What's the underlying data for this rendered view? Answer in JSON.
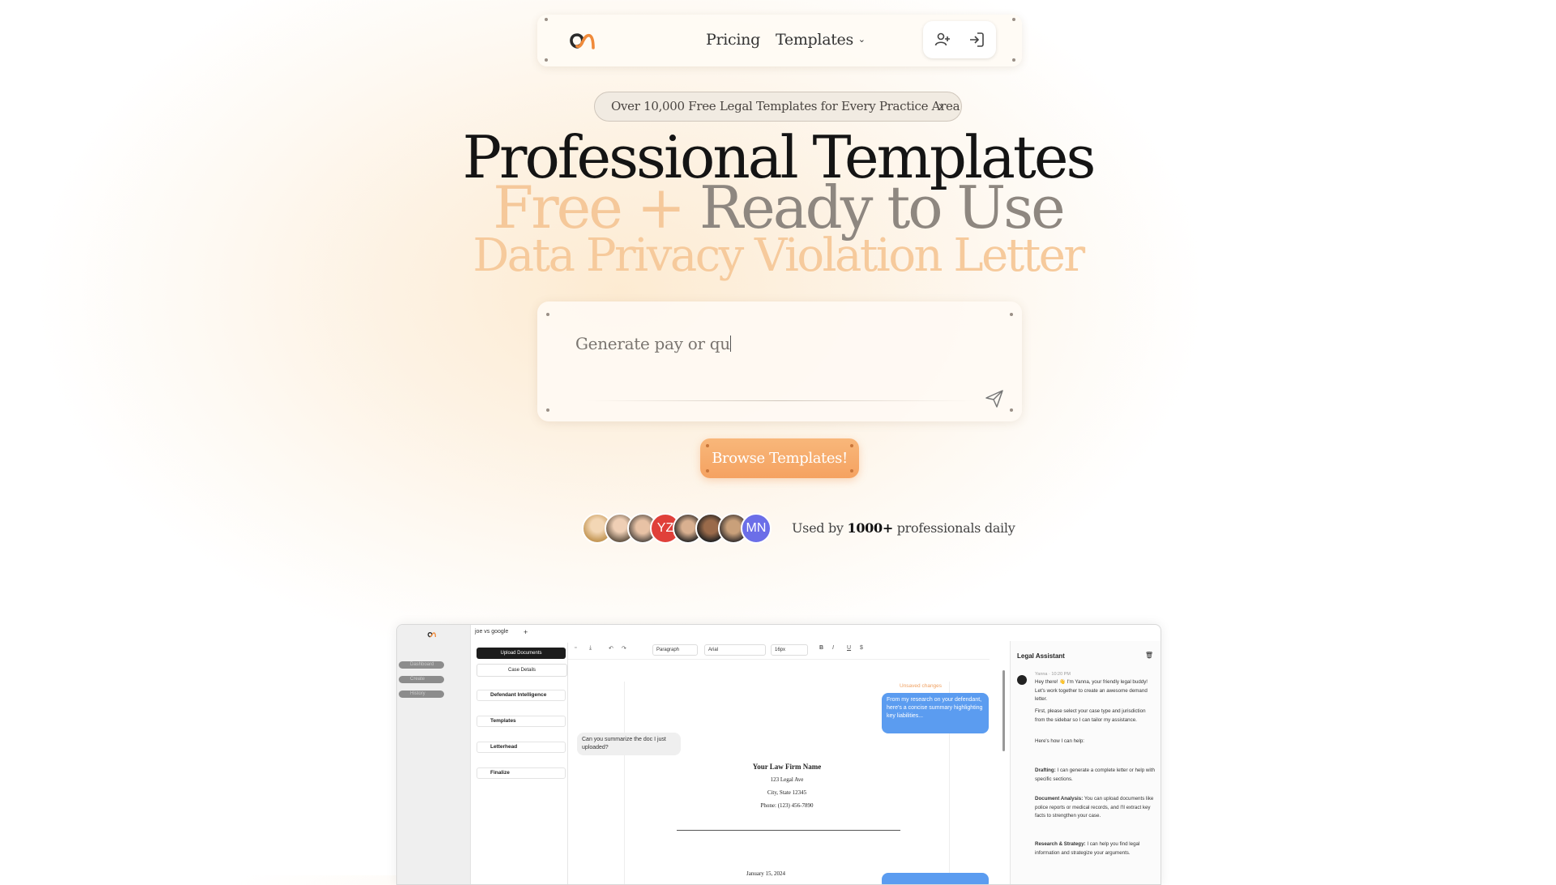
{
  "nav": {
    "pricing": "Pricing",
    "templates": "Templates",
    "templates_chevron": "⌄",
    "icons": [
      "logo-icon",
      "add-user-icon",
      "sign-in-icon"
    ]
  },
  "banner": {
    "text": "Over 10,000 Free Legal Templates for Every Practice Area",
    "arrow": "›"
  },
  "hero": {
    "line1": "Professional Templates",
    "line2_a": "Free +",
    "line2_b": "Ready to Use",
    "line3": "Data Privacy Violation Letter"
  },
  "prompt": {
    "text": "Generate pay or qu"
  },
  "cta": {
    "browse": "Browse Templates!"
  },
  "social": {
    "avatars": [
      "",
      "",
      "",
      "YZ",
      "",
      "",
      "",
      "MN"
    ],
    "used_prefix": "Used by",
    "used_count": "1000+",
    "used_suffix": "professionals daily"
  },
  "colors": {
    "accent": "#f5a261",
    "hero_peach": "#f5c89a",
    "hero_gray": "#8e8780",
    "avatar_red": "#e0403a",
    "avatar_purple": "#6b6ee8",
    "chat_blue": "#5b9cf0"
  },
  "app": {
    "sidebar": [
      "Dashboard",
      "Create",
      "History"
    ],
    "tab": "joe vs google",
    "tab_add": "+",
    "upload": "Upload Documents",
    "case_details": "Case Details",
    "panel_items": [
      "Defendant Intelligence",
      "Templates",
      "Letterhead",
      "Finalize"
    ],
    "toolbar": {
      "paragraph": "Paragraph",
      "font": "Arial",
      "size": "16px",
      "bold": "B",
      "italic": "I",
      "underline": "U",
      "strike": "$"
    },
    "unsaved": "Unsaved changes",
    "bubble_user": "Can you summarize the doc I just uploaded?",
    "bubble_bot": "From my research on your defendant, here's a concise summary highlighting key liabilities...",
    "doc": {
      "firm": "Your Law Firm Name",
      "addr1": "123 Legal Ave",
      "addr2": "City, State 12345",
      "phone": "Phone: (123) 456-7890",
      "date": "January 15, 2024"
    },
    "assistant": {
      "title": "Legal Assistant",
      "meta": "Yanna · 10:20 PM",
      "greeting": "Hey there! 👋 I'm Yanna, your friendly legal buddy! Let's work together to create an awesome demand letter.",
      "p2": "First, please select your case type and jurisdiction from the sidebar so I can tailor my assistance.",
      "p3": "Here's how I can help:",
      "drafting_label": "Drafting:",
      "drafting": "I can generate a complete letter or help with specific sections.",
      "analysis_label": "Document Analysis:",
      "analysis": "You can upload documents like police reports or medical records, and I'll extract key facts to strengthen your case.",
      "research_label": "Research & Strategy:",
      "research": "I can help you find legal information and strategize your arguments."
    }
  }
}
